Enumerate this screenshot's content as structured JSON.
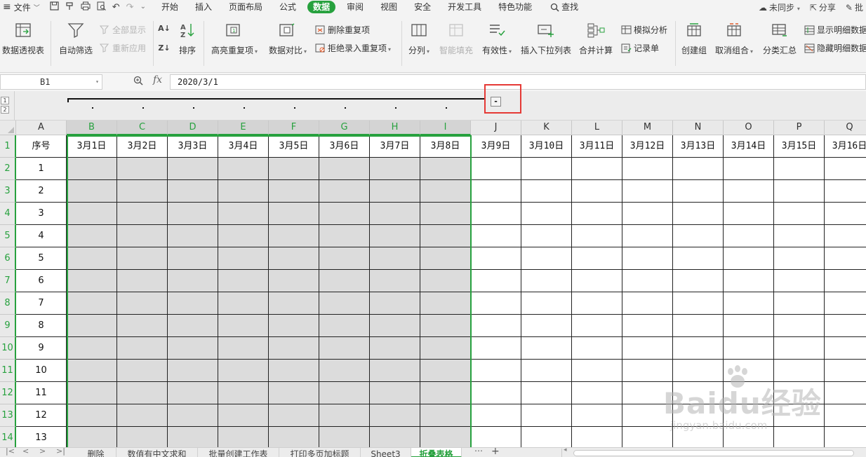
{
  "menubar": {
    "file_label": "文件",
    "tabs": [
      "开始",
      "插入",
      "页面布局",
      "公式",
      "数据",
      "审阅",
      "视图",
      "安全",
      "开发工具",
      "特色功能"
    ],
    "active_tab": "数据",
    "search_label": "查找",
    "sync_label": "未同步",
    "share_label": "分享",
    "comment_label": "批"
  },
  "ribbon": {
    "pivot": "数据透视表",
    "autofilter": "自动筛选",
    "show_all": "全部显示",
    "reapply": "重新应用",
    "sort": "排序",
    "highlight_dup": "高亮重复项",
    "compare": "数据对比",
    "remove_dup": "删除重复项",
    "reject_dup": "拒绝录入重复项",
    "split": "分列",
    "smart_fill": "智能填充",
    "validity": "有效性",
    "insert_dropdown": "插入下拉列表",
    "consolidate": "合并计算",
    "what_if": "模拟分析",
    "record_form": "记录单",
    "create_group": "创建组",
    "ungroup": "取消组合",
    "subtotal": "分类汇总",
    "show_detail": "显示明细数据",
    "hide_detail": "隐藏明细数据"
  },
  "formula_bar": {
    "name_box": "B1",
    "fx_label": "fx",
    "value": "2020/3/1"
  },
  "outline": {
    "levels": [
      "1",
      "2"
    ],
    "collapse_symbol": "-"
  },
  "columns": [
    "A",
    "B",
    "C",
    "D",
    "E",
    "F",
    "G",
    "H",
    "I",
    "J",
    "K",
    "L",
    "M",
    "N",
    "O",
    "P",
    "Q"
  ],
  "rows": [
    "1",
    "2",
    "3",
    "4",
    "5",
    "6",
    "7",
    "8",
    "9",
    "10",
    "11",
    "12",
    "13",
    "14"
  ],
  "header_row": [
    "序号",
    "3月1日",
    "3月2日",
    "3月3日",
    "3月4日",
    "3月5日",
    "3月6日",
    "3月7日",
    "3月8日",
    "3月9日",
    "3月10日",
    "3月11日",
    "3月12日",
    "3月13日",
    "3月14日",
    "3月15日",
    "3月16日"
  ],
  "serial_numbers": [
    "1",
    "2",
    "3",
    "4",
    "5",
    "6",
    "7",
    "8",
    "9",
    "10",
    "11",
    "12",
    "13"
  ],
  "selected_columns": [
    "B",
    "C",
    "D",
    "E",
    "F",
    "G",
    "H",
    "I"
  ],
  "sheet_tabs": [
    "删除",
    "数值有中文求和",
    "批量创建工作表",
    "打印多页加标题",
    "Sheet3",
    "折叠表格"
  ],
  "active_sheet": "折叠表格",
  "watermark": {
    "brand": "Baidu经验",
    "url": "jingyan.baidu.com"
  },
  "colors": {
    "accent": "#27a13e",
    "highlight": "#e53935",
    "selection_fill": "#dcdcdc"
  }
}
